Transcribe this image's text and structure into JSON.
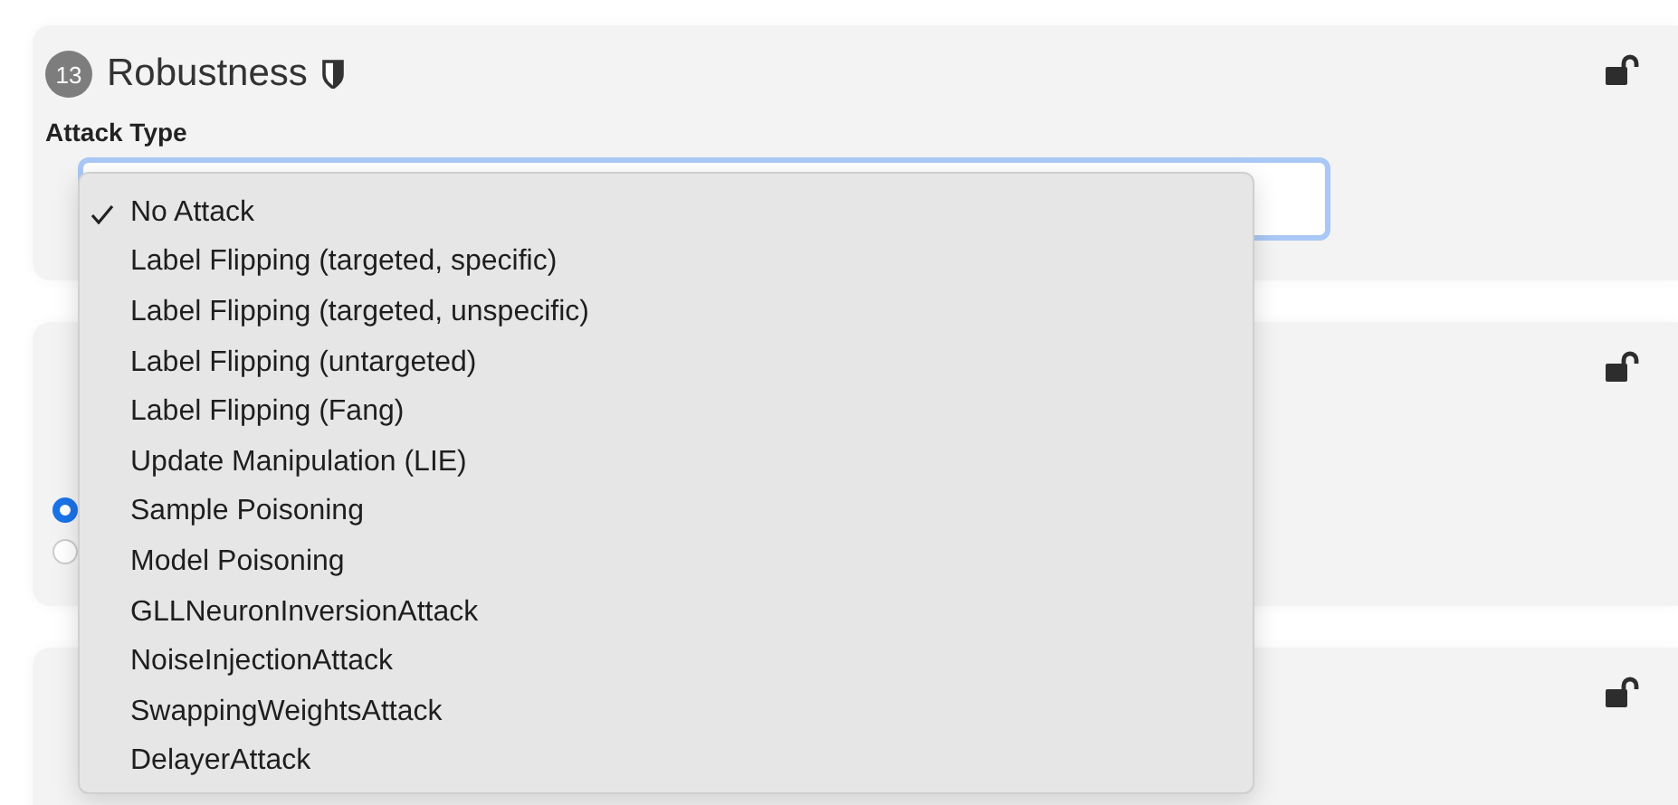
{
  "sections": [
    {
      "number": "13",
      "title": "Robustness",
      "locked": false,
      "field": {
        "label": "Attack Type",
        "focused": true
      }
    },
    {
      "locked": false,
      "radios": [
        {
          "selected": true
        },
        {
          "selected": false
        }
      ]
    },
    {
      "locked": false
    }
  ],
  "dropdown": {
    "items": [
      {
        "label": "No Attack",
        "selected": true
      },
      {
        "label": "Label Flipping (targeted, specific)",
        "selected": false
      },
      {
        "label": "Label Flipping (targeted, unspecific)",
        "selected": false
      },
      {
        "label": "Label Flipping (untargeted)",
        "selected": false
      },
      {
        "label": "Label Flipping (Fang)",
        "selected": false
      },
      {
        "label": "Update Manipulation (LIE)",
        "selected": false
      },
      {
        "label": "Sample Poisoning",
        "selected": false
      },
      {
        "label": "Model Poisoning",
        "selected": false
      },
      {
        "label": "GLLNeuronInversionAttack",
        "selected": false
      },
      {
        "label": "NoiseInjectionAttack",
        "selected": false
      },
      {
        "label": "SwappingWeightsAttack",
        "selected": false
      },
      {
        "label": "DelayerAttack",
        "selected": false
      }
    ]
  }
}
